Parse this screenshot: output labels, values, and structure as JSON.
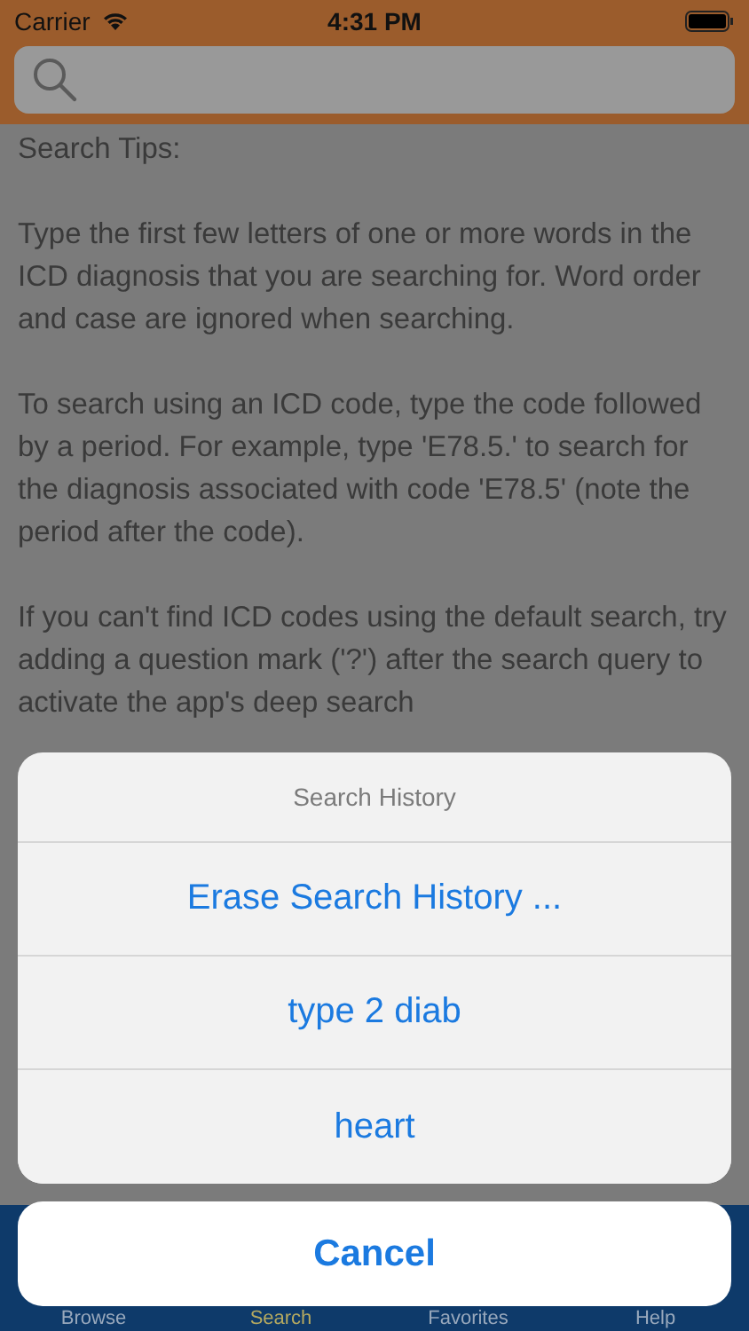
{
  "status_bar": {
    "carrier": "Carrier",
    "time": "4:31 PM"
  },
  "tips": [
    "Search Tips:",
    "Type the first few letters of one or more words in the ICD diagnosis that you are searching for. Word order and case are ignored when searching.",
    "To search using an ICD code, type the code followed by a period. For example, type 'E78.5.' to search for the diagnosis associated with code 'E78.5' (note the period after the code).",
    "If you can't find  ICD codes using the default search, try adding a question mark ('?') after the search query to activate the app's deep search"
  ],
  "tab_bar": [
    {
      "label": "Browse",
      "selected": false
    },
    {
      "label": "Search",
      "selected": true
    },
    {
      "label": "Favorites",
      "selected": false
    },
    {
      "label": "Help",
      "selected": false
    }
  ],
  "action_sheet": {
    "title": "Search History",
    "actions": [
      "Erase Search History ...",
      "type 2 diab",
      "heart"
    ],
    "cancel": "Cancel"
  }
}
